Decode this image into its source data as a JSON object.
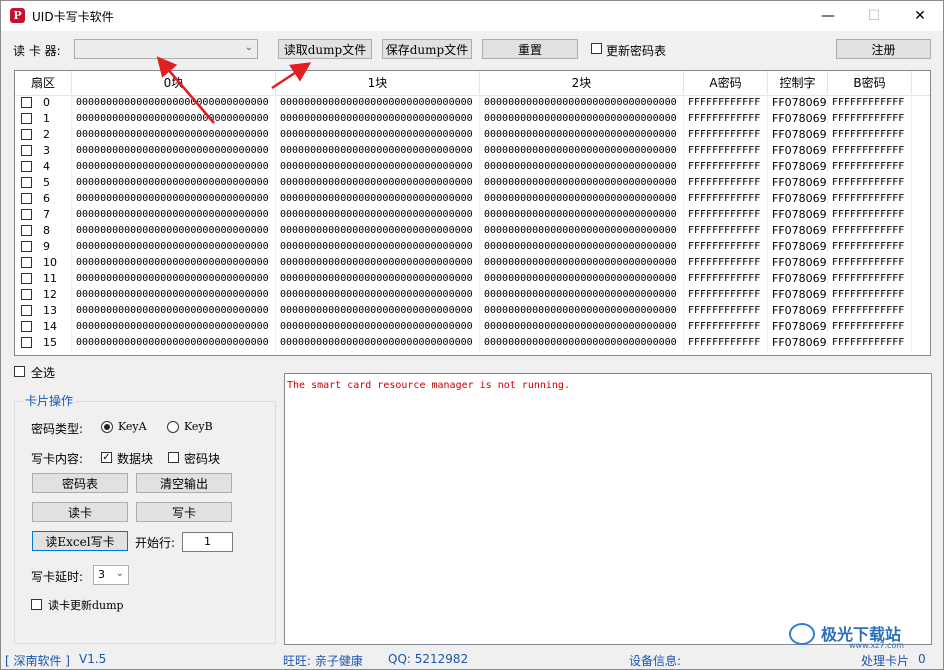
{
  "window": {
    "title": "UID卡写卡软件",
    "icon": "P",
    "minimize": "—",
    "maximize": "☐",
    "close": "✕"
  },
  "toolbar": {
    "reader_label": "读 卡 器:",
    "reader_value": "",
    "read_dump": "读取dump文件",
    "save_dump": "保存dump文件",
    "reset": "重置",
    "update_keys": "更新密码表",
    "register": "注册"
  },
  "grid": {
    "headers": [
      "扇区",
      "0块",
      "1块",
      "2块",
      "A密码",
      "控制字",
      "B密码"
    ],
    "rows": [
      {
        "sector": "0",
        "b0": "00000000000000000000000000000000",
        "b1": "00000000000000000000000000000000",
        "b2": "00000000000000000000000000000000",
        "keyA": "FFFFFFFFFFFF",
        "ctrl": "FF078069",
        "keyB": "FFFFFFFFFFFF"
      },
      {
        "sector": "1",
        "b0": "00000000000000000000000000000000",
        "b1": "00000000000000000000000000000000",
        "b2": "00000000000000000000000000000000",
        "keyA": "FFFFFFFFFFFF",
        "ctrl": "FF078069",
        "keyB": "FFFFFFFFFFFF"
      },
      {
        "sector": "2",
        "b0": "00000000000000000000000000000000",
        "b1": "00000000000000000000000000000000",
        "b2": "00000000000000000000000000000000",
        "keyA": "FFFFFFFFFFFF",
        "ctrl": "FF078069",
        "keyB": "FFFFFFFFFFFF"
      },
      {
        "sector": "3",
        "b0": "00000000000000000000000000000000",
        "b1": "00000000000000000000000000000000",
        "b2": "00000000000000000000000000000000",
        "keyA": "FFFFFFFFFFFF",
        "ctrl": "FF078069",
        "keyB": "FFFFFFFFFFFF"
      },
      {
        "sector": "4",
        "b0": "00000000000000000000000000000000",
        "b1": "00000000000000000000000000000000",
        "b2": "00000000000000000000000000000000",
        "keyA": "FFFFFFFFFFFF",
        "ctrl": "FF078069",
        "keyB": "FFFFFFFFFFFF"
      },
      {
        "sector": "5",
        "b0": "00000000000000000000000000000000",
        "b1": "00000000000000000000000000000000",
        "b2": "00000000000000000000000000000000",
        "keyA": "FFFFFFFFFFFF",
        "ctrl": "FF078069",
        "keyB": "FFFFFFFFFFFF"
      },
      {
        "sector": "6",
        "b0": "00000000000000000000000000000000",
        "b1": "00000000000000000000000000000000",
        "b2": "00000000000000000000000000000000",
        "keyA": "FFFFFFFFFFFF",
        "ctrl": "FF078069",
        "keyB": "FFFFFFFFFFFF"
      },
      {
        "sector": "7",
        "b0": "00000000000000000000000000000000",
        "b1": "00000000000000000000000000000000",
        "b2": "00000000000000000000000000000000",
        "keyA": "FFFFFFFFFFFF",
        "ctrl": "FF078069",
        "keyB": "FFFFFFFFFFFF"
      },
      {
        "sector": "8",
        "b0": "00000000000000000000000000000000",
        "b1": "00000000000000000000000000000000",
        "b2": "00000000000000000000000000000000",
        "keyA": "FFFFFFFFFFFF",
        "ctrl": "FF078069",
        "keyB": "FFFFFFFFFFFF"
      },
      {
        "sector": "9",
        "b0": "00000000000000000000000000000000",
        "b1": "00000000000000000000000000000000",
        "b2": "00000000000000000000000000000000",
        "keyA": "FFFFFFFFFFFF",
        "ctrl": "FF078069",
        "keyB": "FFFFFFFFFFFF"
      },
      {
        "sector": "10",
        "b0": "00000000000000000000000000000000",
        "b1": "00000000000000000000000000000000",
        "b2": "00000000000000000000000000000000",
        "keyA": "FFFFFFFFFFFF",
        "ctrl": "FF078069",
        "keyB": "FFFFFFFFFFFF"
      },
      {
        "sector": "11",
        "b0": "00000000000000000000000000000000",
        "b1": "00000000000000000000000000000000",
        "b2": "00000000000000000000000000000000",
        "keyA": "FFFFFFFFFFFF",
        "ctrl": "FF078069",
        "keyB": "FFFFFFFFFFFF"
      },
      {
        "sector": "12",
        "b0": "00000000000000000000000000000000",
        "b1": "00000000000000000000000000000000",
        "b2": "00000000000000000000000000000000",
        "keyA": "FFFFFFFFFFFF",
        "ctrl": "FF078069",
        "keyB": "FFFFFFFFFFFF"
      },
      {
        "sector": "13",
        "b0": "00000000000000000000000000000000",
        "b1": "00000000000000000000000000000000",
        "b2": "00000000000000000000000000000000",
        "keyA": "FFFFFFFFFFFF",
        "ctrl": "FF078069",
        "keyB": "FFFFFFFFFFFF"
      },
      {
        "sector": "14",
        "b0": "00000000000000000000000000000000",
        "b1": "00000000000000000000000000000000",
        "b2": "00000000000000000000000000000000",
        "keyA": "FFFFFFFFFFFF",
        "ctrl": "FF078069",
        "keyB": "FFFFFFFFFFFF"
      },
      {
        "sector": "15",
        "b0": "00000000000000000000000000000000",
        "b1": "00000000000000000000000000000000",
        "b2": "00000000000000000000000000000000",
        "keyA": "FFFFFFFFFFFF",
        "ctrl": "FF078069",
        "keyB": "FFFFFFFFFFFF"
      }
    ]
  },
  "select_all": "全选",
  "card_ops": {
    "title": "卡片操作",
    "key_type_label": "密码类型:",
    "key_a": "KeyA",
    "key_b": "KeyB",
    "key_a_selected": true,
    "write_content_label": "写卡内容:",
    "data_block": "数据块",
    "data_block_checked": true,
    "key_block": "密码块",
    "key_block_checked": false,
    "key_table_btn": "密码表",
    "clear_output_btn": "清空输出",
    "read_card_btn": "读卡",
    "write_card_btn": "写卡",
    "read_excel_btn": "读Excel写卡",
    "start_row_label": "开始行:",
    "start_row_value": "1",
    "delay_label": "写卡延时:",
    "delay_value": "3",
    "update_dump": "读卡更新dump"
  },
  "output": {
    "message": "The smart card resource manager is not running."
  },
  "status": {
    "brand": "[ 深南软件 ]",
    "version": "V1.5",
    "wangwang": "旺旺: 亲子健康",
    "qq": "QQ: 5212982",
    "device_info": "设备信息:",
    "processed": "处理卡片",
    "processed_count": "0"
  },
  "annotations": {
    "arrow_color": "#e02020"
  },
  "watermark": {
    "text": "极光下载站",
    "url": "www.xz7.com"
  }
}
